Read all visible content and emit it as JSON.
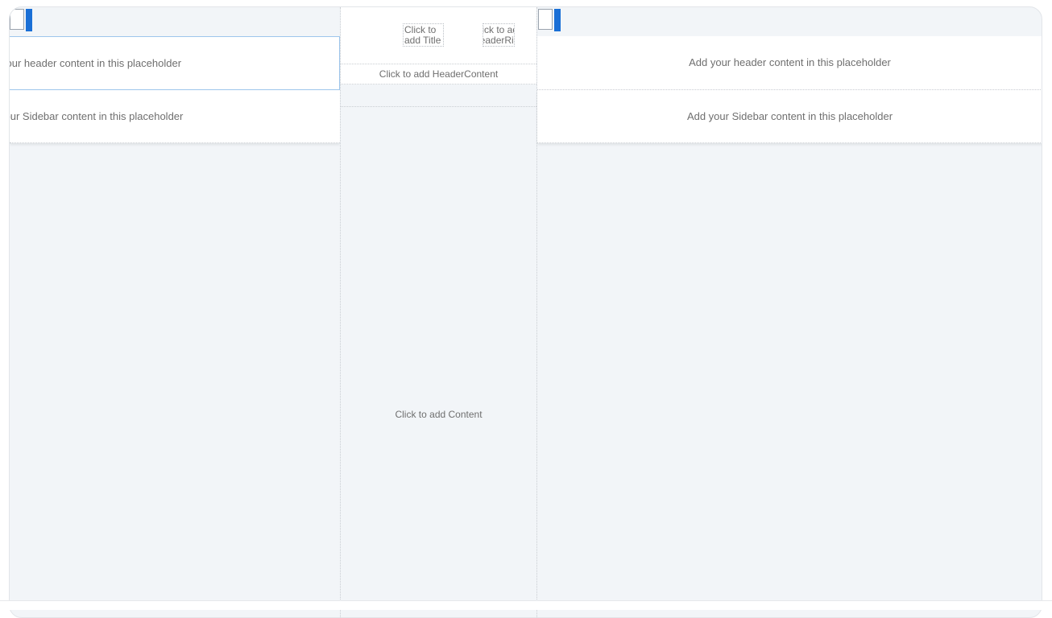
{
  "left_pane": {
    "header_text": "your header content in this placeholder",
    "sidebar_text": "your Sidebar content in this placeholder"
  },
  "middle": {
    "title_text": "Click to add Title",
    "header_right_text": "Click to add HeaderRight",
    "header_content_text": "Click to add HeaderContent",
    "content_text": "Click to add Content"
  },
  "right_pane": {
    "header_text": "Add your header content in this placeholder",
    "sidebar_text": "Add your Sidebar content in this placeholder"
  },
  "colors": {
    "accent": "#1a6fd6",
    "canvas": "#f2f5f8",
    "selection_border": "#9ec6ec"
  },
  "icons": {
    "pane_toggle": "sidebar-toggle-icon"
  }
}
